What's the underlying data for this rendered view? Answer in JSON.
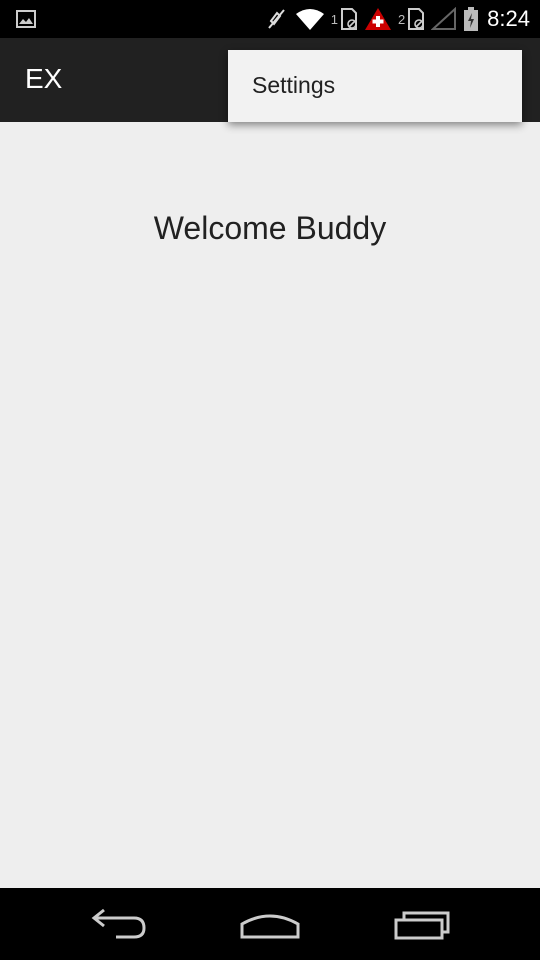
{
  "status_bar": {
    "time": "8:24",
    "sim1_label": "1",
    "sim2_label": "2",
    "icons": [
      "image-notification-icon",
      "mute-icon",
      "wifi-icon",
      "sim-card-1-icon",
      "alert-icon",
      "sim-card-2-icon",
      "signal-icon",
      "battery-icon"
    ]
  },
  "action_bar": {
    "title": "EX"
  },
  "overflow_menu": {
    "items": [
      {
        "label": "Settings"
      }
    ]
  },
  "main": {
    "welcome_text": "Welcome Buddy"
  },
  "nav_bar": {
    "icons": [
      "back-icon",
      "home-icon",
      "recents-icon"
    ]
  },
  "colors": {
    "status_bar_bg": "#000000",
    "action_bar_bg": "#212121",
    "content_bg": "#eeeeee",
    "menu_bg": "#f2f2f2",
    "alert_red": "#cc0000"
  }
}
